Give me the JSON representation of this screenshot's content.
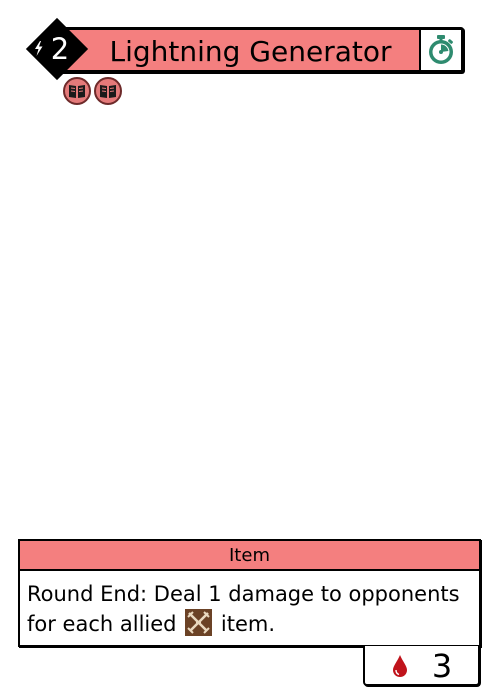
{
  "card": {
    "title": "Lightning Generator",
    "cost": "2",
    "cost_icon": "lightning-bolt-icon",
    "timing_icon": "stopwatch-icon",
    "pack_icons": [
      "book-icon",
      "book-icon"
    ],
    "type": "Item",
    "effect_before_icon": "Round End: Deal 1 damage to opponents for each allied",
    "effect_icon": "crossed-swords-icon",
    "effect_after_icon": "item.",
    "stat_icon": "blood-drop-icon",
    "stat_value": "3"
  },
  "colors": {
    "accent": "#f47f7f",
    "timing_icon": "#2e8b6f",
    "blood": "#c0141c",
    "effect_icon_bg": "#6b4226"
  }
}
